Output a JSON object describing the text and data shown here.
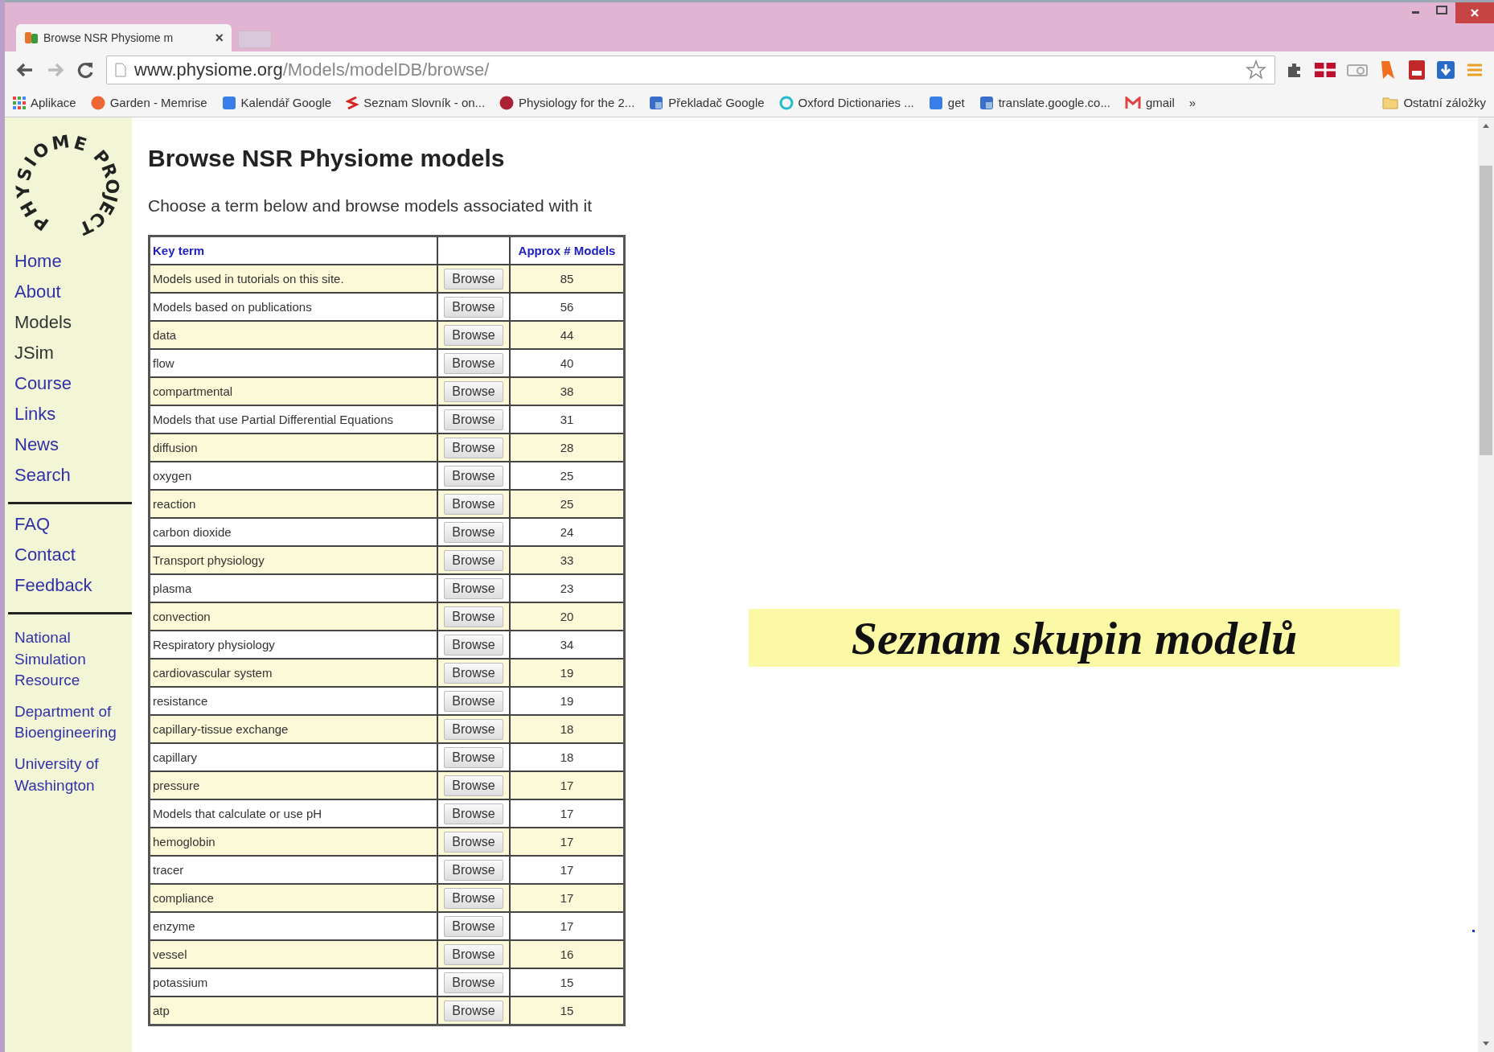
{
  "browser": {
    "tab": {
      "title": "Browse NSR Physiome m",
      "close": "×"
    },
    "address": {
      "host": "www.physiome.org",
      "path": "/Models/modelDB/browse/"
    },
    "bookmarks": [
      {
        "label": "Aplikace",
        "kind": "apps"
      },
      {
        "label": "Garden - Memrise",
        "kind": "flame"
      },
      {
        "label": "Kalendář Google",
        "kind": "blue"
      },
      {
        "label": "Seznam Slovník - on...",
        "kind": "seznam"
      },
      {
        "label": "Physiology for the 2...",
        "kind": "disc"
      },
      {
        "label": "Překladač Google",
        "kind": "translate"
      },
      {
        "label": "Oxford Dictionaries ...",
        "kind": "ring"
      },
      {
        "label": "get",
        "kind": "blue"
      },
      {
        "label": "translate.google.co...",
        "kind": "translate"
      },
      {
        "label": "gmail",
        "kind": "gmail"
      }
    ],
    "overflow": "»",
    "other": "Ostatní záložky"
  },
  "logo": {
    "top": "PHYSIOME",
    "bottom": "PROJECT"
  },
  "sidebar": {
    "groups": [
      [
        {
          "label": "Home",
          "selected": false
        },
        {
          "label": "About",
          "selected": false
        },
        {
          "label": "Models",
          "selected": true
        },
        {
          "label": "JSim",
          "selected": true
        },
        {
          "label": "Course",
          "selected": false
        },
        {
          "label": "Links",
          "selected": false
        },
        {
          "label": "News",
          "selected": false
        },
        {
          "label": "Search",
          "selected": false
        }
      ],
      [
        {
          "label": "FAQ",
          "selected": false
        },
        {
          "label": "Contact",
          "selected": false
        },
        {
          "label": "Feedback",
          "selected": false
        }
      ]
    ],
    "affiliations": [
      "National Simulation Resource",
      "Department of Bioengineering",
      "University of Washington"
    ]
  },
  "title": "Browse NSR Physiome models",
  "intro": "Choose a term below and browse models associated with it",
  "table": {
    "columns": [
      "Key term",
      "",
      "Approx # Models"
    ],
    "rows": [
      {
        "term": "Models used in tutorials on this site.",
        "button": "Browse",
        "count": "85"
      },
      {
        "term": "Models based on publications",
        "button": "Browse",
        "count": "56"
      },
      {
        "term": "data",
        "button": "Browse",
        "count": "44"
      },
      {
        "term": "flow",
        "button": "Browse",
        "count": "40"
      },
      {
        "term": "compartmental",
        "button": "Browse",
        "count": "38"
      },
      {
        "term": "Models that use Partial Differential Equations",
        "button": "Browse",
        "count": "31"
      },
      {
        "term": "diffusion",
        "button": "Browse",
        "count": "28"
      },
      {
        "term": "oxygen",
        "button": "Browse",
        "count": "25"
      },
      {
        "term": "reaction",
        "button": "Browse",
        "count": "25"
      },
      {
        "term": "carbon dioxide",
        "button": "Browse",
        "count": "24"
      },
      {
        "term": "Transport physiology",
        "button": "Browse",
        "count": "33"
      },
      {
        "term": "plasma",
        "button": "Browse",
        "count": "23"
      },
      {
        "term": "convection",
        "button": "Browse",
        "count": "20"
      },
      {
        "term": "Respiratory physiology",
        "button": "Browse",
        "count": "34"
      },
      {
        "term": "cardiovascular system",
        "button": "Browse",
        "count": "19"
      },
      {
        "term": "resistance",
        "button": "Browse",
        "count": "19"
      },
      {
        "term": "capillary-tissue exchange",
        "button": "Browse",
        "count": "18"
      },
      {
        "term": "capillary",
        "button": "Browse",
        "count": "18"
      },
      {
        "term": "pressure",
        "button": "Browse",
        "count": "17"
      },
      {
        "term": "Models that calculate or use pH",
        "button": "Browse",
        "count": "17"
      },
      {
        "term": "hemoglobin",
        "button": "Browse",
        "count": "17"
      },
      {
        "term": "tracer",
        "button": "Browse",
        "count": "17"
      },
      {
        "term": "compliance",
        "button": "Browse",
        "count": "17"
      },
      {
        "term": "enzyme",
        "button": "Browse",
        "count": "17"
      },
      {
        "term": "vessel",
        "button": "Browse",
        "count": "16"
      },
      {
        "term": "potassium",
        "button": "Browse",
        "count": "15"
      },
      {
        "term": "atp",
        "button": "Browse",
        "count": "15"
      }
    ]
  },
  "banner": "Seznam skupin modelů"
}
